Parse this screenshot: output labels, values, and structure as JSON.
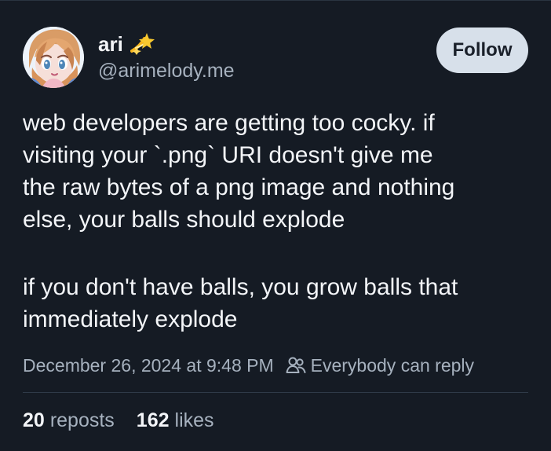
{
  "post": {
    "author": {
      "display_name": "ari",
      "emoji_icon": "dizzy-star-emoji-icon",
      "handle": "@arimelody.me",
      "avatar": "anime-avatar"
    },
    "follow_label": "Follow",
    "lines": [
      "web developers are getting too cocky. if",
      "visiting your `.png` URI doesn't give me",
      "the raw bytes of a png image and nothing",
      "else, your balls should explode",
      "if you don't have balls, you grow balls that",
      "immediately explode"
    ],
    "timestamp": "December 26, 2024 at 9:48 PM",
    "reply_icon": "people-icon",
    "reply_setting": "Everybody can reply",
    "reposts": {
      "count": "20",
      "label": "reposts"
    },
    "likes": {
      "count": "162",
      "label": "likes"
    }
  },
  "colors": {
    "background": "#151b24",
    "primary_text": "#f3f5f8",
    "secondary_text": "#a6b1be",
    "button_background": "#d7e0ea",
    "button_text": "#1a202a",
    "divider": "#2f3a48"
  }
}
